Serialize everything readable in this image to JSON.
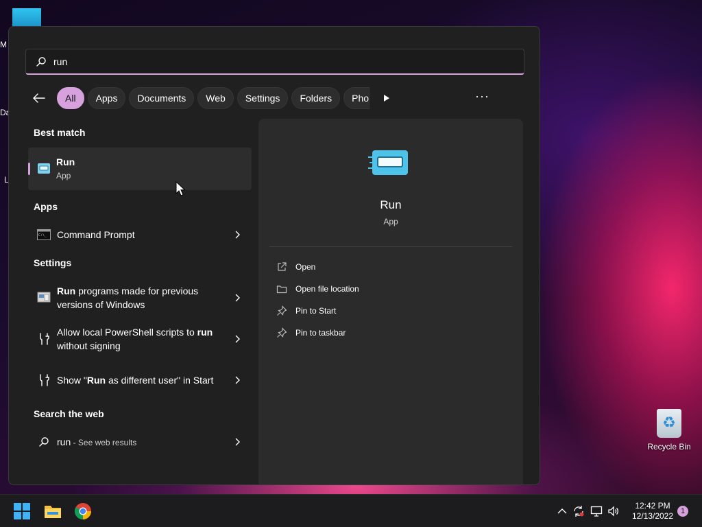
{
  "desktop": {
    "left_fragments": [
      "M",
      "Da",
      "L"
    ],
    "recycle_bin_label": "Recycle Bin"
  },
  "search": {
    "query": "run",
    "filters": [
      "All",
      "Apps",
      "Documents",
      "Web",
      "Settings",
      "Folders",
      "Pho"
    ],
    "active_filter": "All"
  },
  "best_match": {
    "section": "Best match",
    "title": "Run",
    "subtitle": "App"
  },
  "apps": {
    "section": "Apps",
    "items": [
      {
        "label": "Command Prompt"
      }
    ]
  },
  "settings": {
    "section": "Settings",
    "items": [
      {
        "bold": "Run",
        "rest": " programs made for previous versions of Windows"
      },
      {
        "pre": "Allow local PowerShell scripts to ",
        "bold": "run",
        "rest": " without signing"
      },
      {
        "pre": "Show \"",
        "bold": "Run",
        "rest": " as different user\" in Start"
      }
    ]
  },
  "web": {
    "section": "Search the web",
    "query": "run",
    "suffix": " - See web results"
  },
  "preview": {
    "title": "Run",
    "subtitle": "App",
    "actions": [
      "Open",
      "Open file location",
      "Pin to Start",
      "Pin to taskbar"
    ]
  },
  "taskbar": {
    "time": "12:42 PM",
    "date": "12/13/2022",
    "notification_count": "1"
  },
  "colors": {
    "accent": "#d6a1dd",
    "panel": "#202020",
    "preview": "#2b2b2b"
  }
}
